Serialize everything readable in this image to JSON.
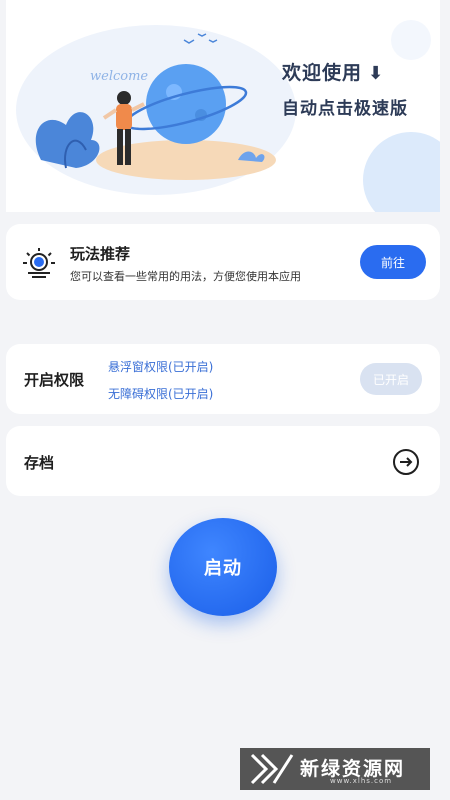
{
  "banner": {
    "welcome": "欢迎使用",
    "subtitle": "自动点击极速版",
    "illustration_text": "welcome"
  },
  "tips": {
    "title": "玩法推荐",
    "description": "您可以查看一些常用的用法，方便您使用本应用",
    "button": "前往"
  },
  "permissions": {
    "title": "开启权限",
    "items": [
      "悬浮窗权限(已开启)",
      "无障碍权限(已开启)"
    ],
    "button": "已开启"
  },
  "archive": {
    "title": "存档"
  },
  "start_button": "启动",
  "watermark": {
    "text": "新绿资源网",
    "url": "www.xlhs.com"
  },
  "colors": {
    "accent": "#2a6cf0",
    "disabled": "#d9e2f1",
    "permission_text": "#3a6fd6",
    "background": "#f3f4f7"
  }
}
